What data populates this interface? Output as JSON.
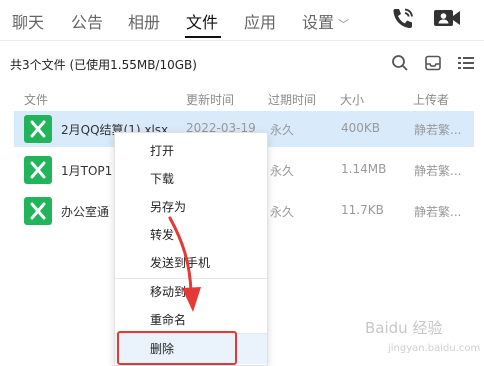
{
  "tabs": [
    "聊天",
    "公告",
    "相册",
    "文件",
    "应用",
    "设置"
  ],
  "active_tab": "文件",
  "header_icons": [
    "phone-icon",
    "video-call-icon"
  ],
  "info": {
    "summary": "共3个文件 (已使用1.55MB/10GB)"
  },
  "toolbar_icons": [
    "search-icon",
    "inbox-icon",
    "list-view-icon"
  ],
  "columns": [
    "文件",
    "更新时间",
    "过期时间",
    "大小",
    "上传者"
  ],
  "files": [
    {
      "name": "2月QQ结算(1).xlsx",
      "updated": "2022-03-19",
      "expire": "永久",
      "size": "400KB",
      "uploader": "静若繁..."
    },
    {
      "name": "1月TOP1",
      "updated": "",
      "expire": "永久",
      "size": "1.14MB",
      "uploader": "静若繁..."
    },
    {
      "name": "办公室通",
      "updated": "",
      "expire": "永久",
      "size": "11.7KB",
      "uploader": "静若繁..."
    }
  ],
  "context_menu": {
    "open": "打开",
    "download": "下载",
    "save_as": "另存为",
    "forward": "转发",
    "send_to_phone": "发送到手机",
    "move_to": "移动到",
    "rename": "重命名",
    "delete": "删除"
  },
  "colors": {
    "selected_row": "#d9ebfb",
    "excel_green": "#21b45a",
    "highlight_red": "#e53935"
  },
  "watermark": {
    "title": "Baidu 经验",
    "sub": "jingyan.baidu.com"
  }
}
